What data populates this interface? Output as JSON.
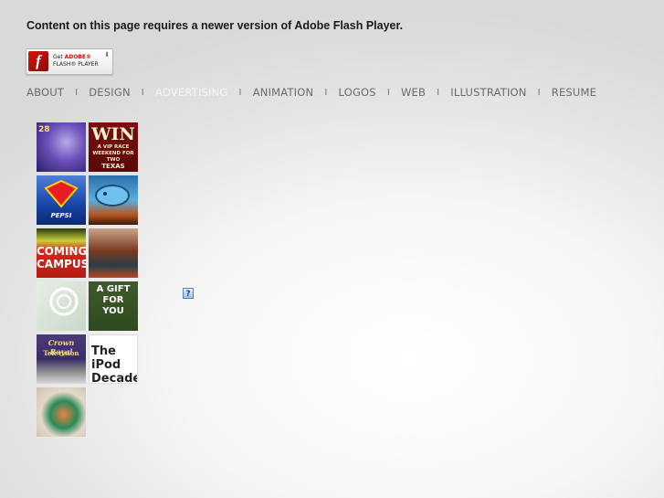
{
  "notice": "Content on this page requires a newer version of Adobe Flash Player.",
  "flash_badge": {
    "logo_glyph": "f",
    "line1_prefix": "Get",
    "line1_brand": "ADOBE®",
    "line2": "FLASH® PLAYER",
    "arrow": "⬇"
  },
  "nav": [
    {
      "label": "ABOUT",
      "active": false
    },
    {
      "label": "DESIGN",
      "active": false
    },
    {
      "label": "ADVERTISING",
      "active": true
    },
    {
      "label": "ANIMATION",
      "active": false
    },
    {
      "label": "LOGOS",
      "active": false
    },
    {
      "label": "WEB",
      "active": false
    },
    {
      "label": "ILLUSTRATION",
      "active": false
    },
    {
      "label": "RESUME",
      "active": false
    }
  ],
  "nav_separator": "I",
  "thumbnails": {
    "t1": "28",
    "t2_big": "WIN",
    "t2_small": "A VIP RACE WEEKEND FOR TWO",
    "t2_state": "TEXAS",
    "t3": "PEPSI",
    "t5_top": "COMING",
    "t5_bottom": "CAMPUS",
    "t8": "A GIFT FOR YOU",
    "t9_top": "Crown Royal",
    "t9_bottom": "Television",
    "t10": "The iPod Decade"
  },
  "plugin_icon": "?"
}
